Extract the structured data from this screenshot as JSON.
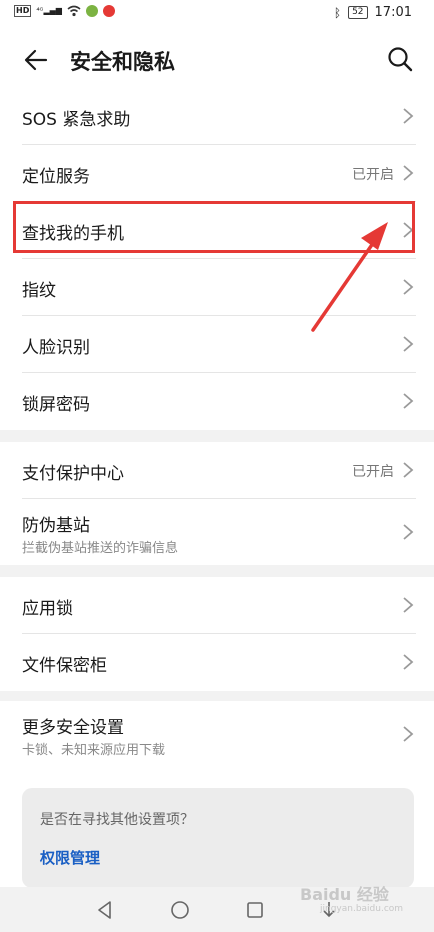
{
  "status_bar": {
    "left_icons": [
      "HD",
      "4G signal",
      "wifi",
      "app-notify-green",
      "app-notify-red"
    ],
    "battery": "52",
    "time": "17:01"
  },
  "header": {
    "title": "安全和隐私"
  },
  "groups": [
    {
      "items": [
        {
          "label": "SOS 紧急求助",
          "value": ""
        },
        {
          "label": "定位服务",
          "value": "已开启"
        },
        {
          "label": "查找我的手机",
          "value": ""
        },
        {
          "label": "指纹",
          "value": ""
        },
        {
          "label": "人脸识别",
          "value": ""
        },
        {
          "label": "锁屏密码",
          "value": ""
        }
      ]
    },
    {
      "items": [
        {
          "label": "支付保护中心",
          "value": "已开启"
        },
        {
          "label": "防伪基站",
          "sub": "拦截伪基站推送的诈骗信息",
          "value": ""
        }
      ]
    },
    {
      "items": [
        {
          "label": "应用锁",
          "value": ""
        },
        {
          "label": "文件保密柜",
          "value": ""
        }
      ]
    },
    {
      "items": [
        {
          "label": "更多安全设置",
          "sub": "卡锁、未知来源应用下载",
          "value": ""
        }
      ]
    }
  ],
  "suggestion": {
    "question": "是否在寻找其他设置项？",
    "link": "权限管理"
  },
  "annotation": {
    "highlight_color": "#e53935"
  },
  "watermark": {
    "text": "Baidu 经验",
    "sub": "jingyan.baidu.com"
  }
}
